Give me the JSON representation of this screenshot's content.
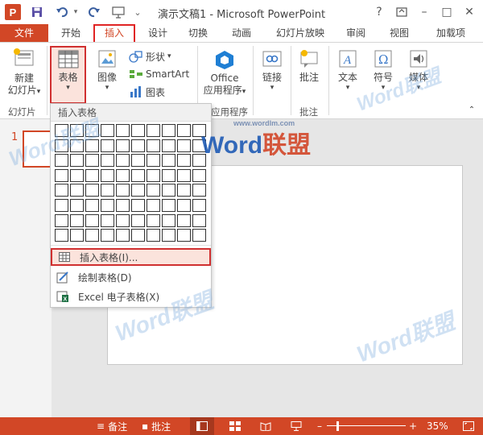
{
  "window": {
    "title": "演示文稿1 - Microsoft PowerPoint",
    "app_logo": "P",
    "help": "?",
    "controls": {
      "minimize": "–",
      "maximize": "□",
      "close": "✕"
    }
  },
  "quick_access": {
    "icons": [
      "save-icon",
      "undo-icon",
      "redo-icon",
      "present-icon",
      "customize-icon"
    ]
  },
  "tabs": [
    {
      "label": "文件"
    },
    {
      "label": "开始"
    },
    {
      "label": "插入"
    },
    {
      "label": "设计"
    },
    {
      "label": "切换"
    },
    {
      "label": "动画"
    },
    {
      "label": "幻灯片放映"
    },
    {
      "label": "审阅"
    },
    {
      "label": "视图"
    },
    {
      "label": "加载项"
    }
  ],
  "active_tab": "插入",
  "ribbon": {
    "new_slide": {
      "line1": "新建",
      "line2": "幻灯片",
      "arrow": "▾"
    },
    "slides_group": "幻灯片",
    "table": {
      "label": "表格",
      "arrow": "▾"
    },
    "image": {
      "label": "图像",
      "arrow": "▾"
    },
    "shapes": {
      "label": "形状",
      "arrow": "▾"
    },
    "smartart": {
      "label": "SmartArt"
    },
    "chart": {
      "label": "图表"
    },
    "office_apps": {
      "line1": "Office",
      "line2": "应用程序",
      "arrow": "▾"
    },
    "apps_group": "应用程序",
    "link": {
      "label": "链接",
      "arrow": "▾"
    },
    "comment": {
      "label": "批注"
    },
    "comments_group": "批注",
    "text": {
      "label": "文本",
      "arrow": "▾"
    },
    "symbol": {
      "label": "符号",
      "arrow": "▾"
    },
    "media": {
      "label": "媒体",
      "arrow": "▾"
    }
  },
  "dropdown": {
    "header": "插入表格",
    "grid_rows": 8,
    "grid_cols": 10,
    "items": [
      {
        "label": "插入表格(I)...",
        "icon": "table-icon",
        "highlighted": true
      },
      {
        "label": "绘制表格(D)",
        "icon": "draw-table-icon",
        "highlighted": false
      },
      {
        "label": "Excel 电子表格(X)",
        "icon": "excel-icon",
        "highlighted": false
      }
    ]
  },
  "thumbnail": {
    "number": "1"
  },
  "statusbar": {
    "notes": "备注",
    "comments": "批注",
    "zoom": "35%",
    "zoom_minus": "–",
    "zoom_plus": "+"
  },
  "watermark": {
    "brand": "Word联盟",
    "url": "www.wordlm.com"
  },
  "colors": {
    "accent": "#d24726",
    "highlight_border": "#d03030",
    "highlight_fill": "#fbe3dc"
  }
}
